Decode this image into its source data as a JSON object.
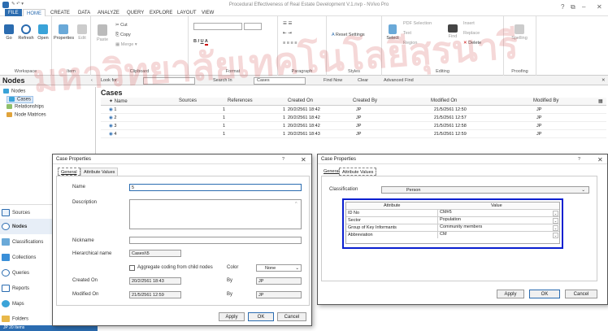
{
  "window": {
    "title": "Procedural Effectiveness of Real Estate Development V.1.nvp - NVivo Pro",
    "help": "?",
    "min": "–",
    "max": "□",
    "close": "✕"
  },
  "tabs": [
    "FILE",
    "HOME",
    "CREATE",
    "DATA",
    "ANALYZE",
    "QUERY",
    "EXPLORE",
    "LAYOUT",
    "VIEW"
  ],
  "ribbon": {
    "workspace": {
      "label": "Workspace",
      "go": "Go",
      "refresh": "Refresh",
      "open": "Open"
    },
    "item": {
      "label": "Item",
      "properties": "Properties",
      "edit": "Edit"
    },
    "clipboard": {
      "label": "Clipboard",
      "paste": "Paste",
      "cut": "Cut",
      "copy": "Copy",
      "merge": "Merge"
    },
    "format": {
      "label": "Format",
      "bold": "B",
      "italic": "I",
      "underline": "U"
    },
    "paragraph": {
      "label": "Paragraph"
    },
    "styles": {
      "label": "Styles",
      "reset": "Reset Settings"
    },
    "editing": {
      "label": "Editing",
      "select": "Select",
      "pdf": "PDF Selection",
      "text": "Text",
      "region": "Region",
      "find": "Find",
      "insert": "Insert",
      "replace": "Replace",
      "delete": "Delete"
    },
    "proofing": {
      "label": "Proofing",
      "spelling": "Spelling"
    }
  },
  "navbar": {
    "nodes_title": "Nodes",
    "look_for": "Look for",
    "search_in": "Search In",
    "search_scope": "Cases",
    "find_now": "Find Now",
    "clear": "Clear",
    "advanced": "Advanced Find"
  },
  "sidebar": {
    "tree": [
      "Nodes",
      "Cases",
      "Relationships",
      "Node Matrices"
    ],
    "nav": [
      "Sources",
      "Nodes",
      "Classifications",
      "Collections",
      "Queries",
      "Reports",
      "Maps",
      "Folders"
    ],
    "status": "JP   20 Items"
  },
  "cases": {
    "title": "Cases",
    "columns": [
      "Name",
      "Sources",
      "References",
      "Created On",
      "Created By",
      "Modified On",
      "Modified By"
    ],
    "rows": [
      {
        "name": "1",
        "sources": "1",
        "refs": "1",
        "created": "20/2/2561 18:42",
        "by": "JP",
        "modified": "21/5/2561 12:50",
        "mby": "JP"
      },
      {
        "name": "2",
        "sources": "1",
        "refs": "1",
        "created": "20/2/2561 18:42",
        "by": "JP",
        "modified": "21/5/2561 12:57",
        "mby": "JP"
      },
      {
        "name": "3",
        "sources": "1",
        "refs": "1",
        "created": "20/2/2561 18:42",
        "by": "JP",
        "modified": "21/5/2561 12:58",
        "mby": "JP"
      },
      {
        "name": "4",
        "sources": "1",
        "refs": "1",
        "created": "20/2/2561 18:43",
        "by": "JP",
        "modified": "21/5/2561 12:59",
        "mby": "JP"
      }
    ]
  },
  "dlg1": {
    "title": "Case Properties",
    "help": "?",
    "close": "✕",
    "tabs": [
      "General",
      "Attribute Values"
    ],
    "name_label": "Name",
    "name_value": "5",
    "desc_label": "Description",
    "nick_label": "Nickname",
    "hier_label": "Hierarchical name",
    "hier_value": "Cases\\\\5",
    "agg_label": "Aggregate coding from child nodes",
    "color_label": "Color",
    "color_value": "None",
    "created_label": "Created On",
    "created_value": "20/2/2561 18:43",
    "created_by_label": "By",
    "created_by": "JP",
    "modified_label": "Modified On",
    "modified_value": "21/5/2561 12:59",
    "modified_by_label": "By",
    "modified_by": "JP",
    "apply": "Apply",
    "ok": "OK",
    "cancel": "Cancel"
  },
  "dlg2": {
    "title": "Case Properties",
    "help": "?",
    "close": "✕",
    "tabs": [
      "General",
      "Attribute Values"
    ],
    "class_label": "Classification",
    "class_value": "Person",
    "attr_header": "Attribute",
    "value_header": "Value",
    "attrs": [
      {
        "attr": "ID No",
        "value": "CM#5"
      },
      {
        "attr": "Sector",
        "value": "Population"
      },
      {
        "attr": "Group of Key Informants",
        "value": "Community members"
      },
      {
        "attr": "Abbreviation",
        "value": "CM"
      }
    ],
    "apply": "Apply",
    "ok": "OK",
    "cancel": "Cancel"
  },
  "watermark": "มหาวิทยาลัยเทคโนโลยีสุรนารี",
  "colors": {
    "accent": "#2b6cb0",
    "highlight": "#0a1fd0"
  }
}
